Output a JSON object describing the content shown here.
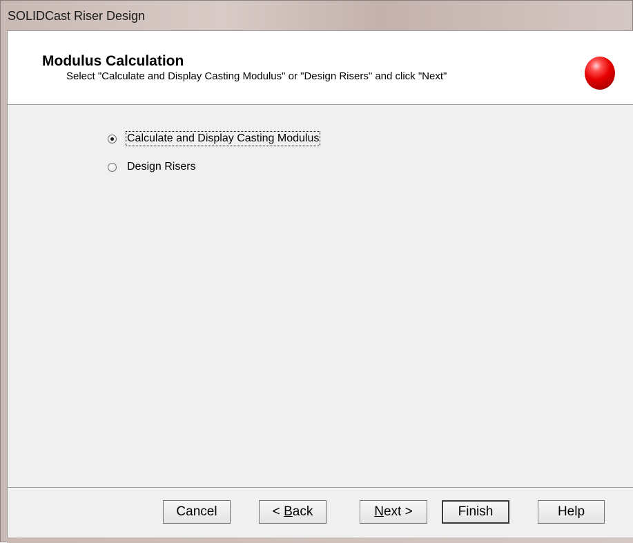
{
  "window": {
    "title": "SOLIDCast Riser Design"
  },
  "header": {
    "title": "Modulus Calculation",
    "subtitle": "Select \"Calculate and Display Casting Modulus\" or \"Design Risers\" and click \"Next\"",
    "icon": "red-ball-icon"
  },
  "options": [
    {
      "label": "Calculate and Display Casting Modulus",
      "checked": true
    },
    {
      "label": "Design Risers",
      "checked": false
    }
  ],
  "buttons": {
    "cancel": "Cancel",
    "back_arrow": "<",
    "back_mnemonic": "B",
    "back_rest": "ack",
    "next_mnemonic": "N",
    "next_rest": "ext",
    "next_arrow": ">",
    "finish": "Finish",
    "help": "Help"
  },
  "colors": {
    "titlebar": "#c9b9b4",
    "client": "#f0f0f0",
    "header": "#ffffff",
    "accent_ball": "#e60000"
  }
}
